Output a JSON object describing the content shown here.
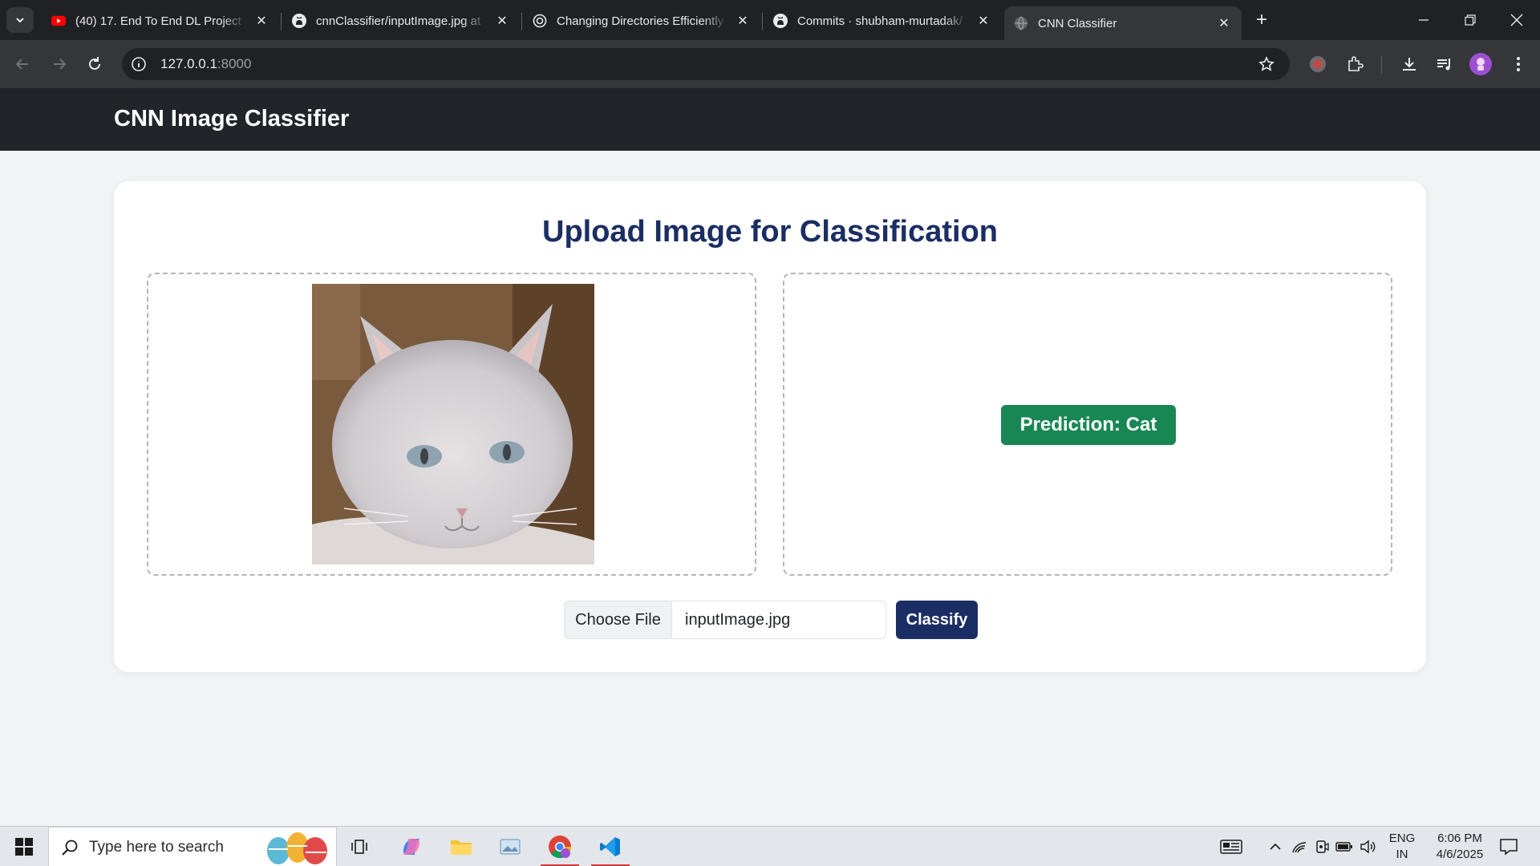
{
  "browser": {
    "tabs": [
      {
        "title": "(40) 17. End To End DL Project I",
        "icon": "youtube-icon"
      },
      {
        "title": "cnnClassifier/inputImage.jpg at",
        "icon": "github-icon"
      },
      {
        "title": "Changing Directories Efficiently",
        "icon": "openai-icon"
      },
      {
        "title": "Commits · shubham-murtadak/",
        "icon": "github-icon"
      },
      {
        "title": "CNN Classifier",
        "icon": "globe-icon",
        "active": true
      }
    ],
    "url_host": "127.0.0.1",
    "url_port": ":8000"
  },
  "app": {
    "brand": "CNN Image Classifier",
    "heading": "Upload Image for Classification",
    "prediction_label": "Prediction: Cat",
    "file_button": "Choose File",
    "file_name": "inputImage.jpg",
    "classify_button": "Classify",
    "colors": {
      "navbar": "#212529",
      "heading": "#1b2e63",
      "prediction": "#198754",
      "classify": "#1b2e63"
    }
  },
  "taskbar": {
    "search_placeholder": "Type here to search",
    "language_top": "ENG",
    "language_bottom": "IN",
    "time": "6:06 PM",
    "date": "4/6/2025"
  }
}
